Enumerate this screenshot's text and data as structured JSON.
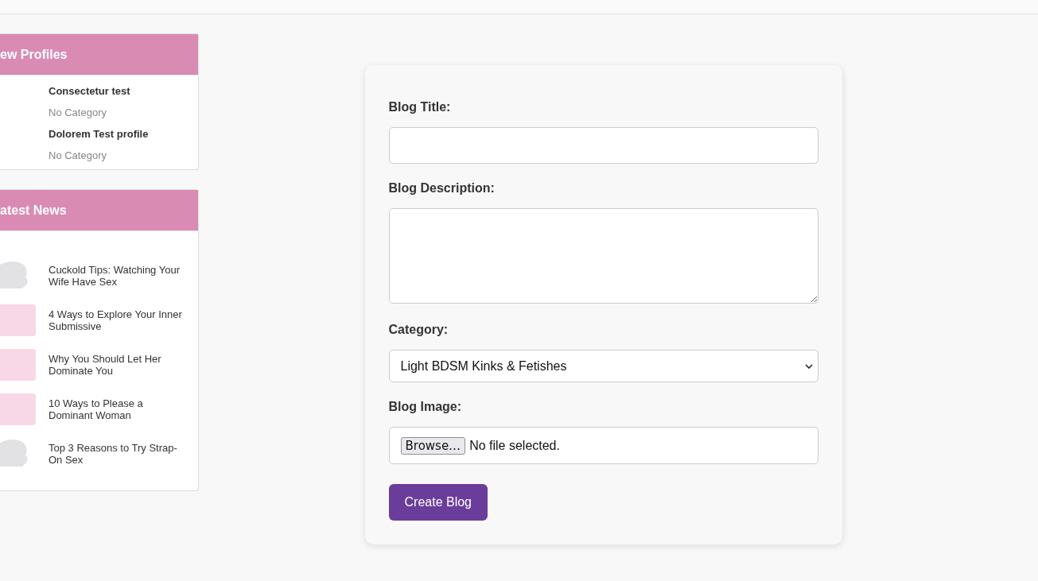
{
  "sidebar": [
    {
      "title": "ew Profiles",
      "kind": "profiles",
      "items": [
        {
          "name": "Consectetur test",
          "category": "No Category"
        },
        {
          "name": "Dolorem Test profile",
          "category": "No Category"
        }
      ]
    },
    {
      "title": "atest News",
      "kind": "news",
      "items": [
        {
          "title": "Cuckold Tips: Watching Your Wife Have Sex",
          "kind": "silhouette"
        },
        {
          "title": "4 Ways to Explore Your Inner Submissive",
          "kind": "image"
        },
        {
          "title": "Why You Should Let Her Dominate You",
          "kind": "image"
        },
        {
          "title": "10 Ways to Please a Dominant Woman",
          "kind": "image"
        },
        {
          "title": "Top 3 Reasons to Try Strap-On Sex",
          "kind": "silhouette"
        }
      ]
    }
  ],
  "form": {
    "fields": [
      {
        "label": "Blog Title:",
        "kind": "text"
      },
      {
        "label": "Blog Description:",
        "kind": "textarea"
      },
      {
        "label": "Category:",
        "kind": "select",
        "value": "Light BDSM Kinks & Fetishes"
      },
      {
        "label": "Blog Image:",
        "kind": "file",
        "button": "Browse…",
        "value": "No file selected."
      }
    ],
    "submit": "Create Blog"
  }
}
